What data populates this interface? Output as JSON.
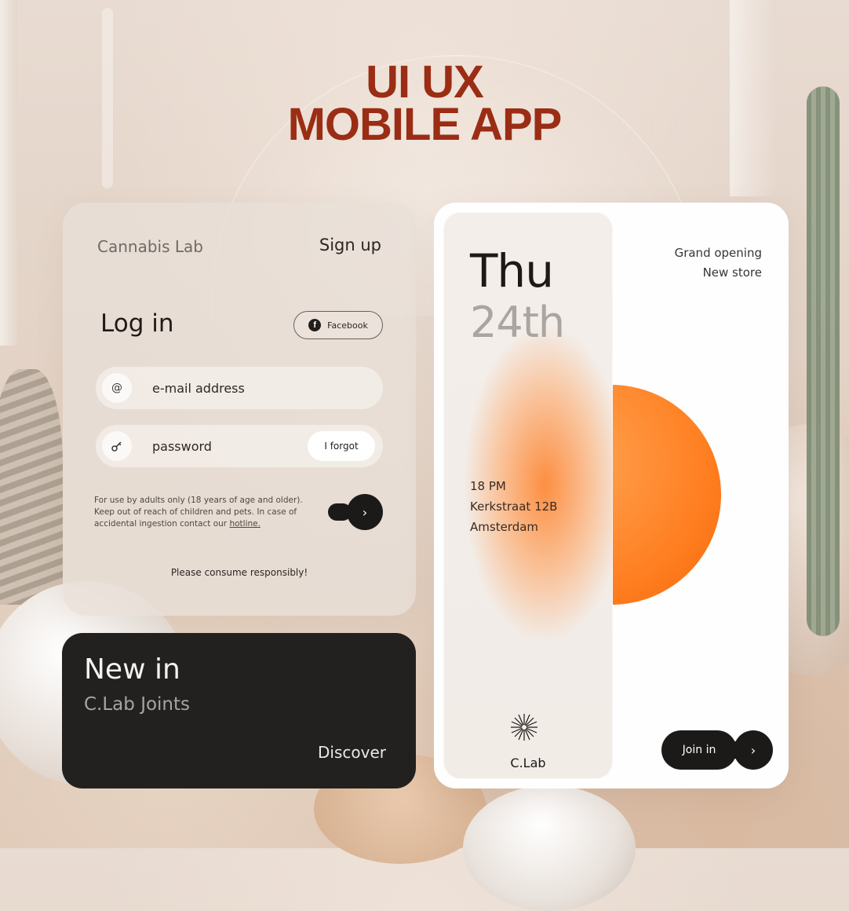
{
  "header": {
    "line1": "UI UX",
    "line2": "MOBILE APP"
  },
  "login": {
    "brand": "Cannabis Lab",
    "signup_label": "Sign up",
    "title": "Log in",
    "facebook_label": "Facebook",
    "email_icon": "@",
    "email_placeholder": "e-mail address",
    "password_placeholder": "password",
    "forgot_label": "I forgot",
    "disclaimer": "For use by adults only (18 years of age and older). Keep out of reach of children and pets. In case of accidental ingestion contact our ",
    "hotline_label": "hotline.",
    "next_glyph": "›",
    "footer_note": "Please consume responsibly!"
  },
  "promo": {
    "title": "New in",
    "subtitle": "C.Lab Joints",
    "cta": "Discover"
  },
  "event": {
    "day": "Thu",
    "date": "24th",
    "tagline_1": "Grand opening",
    "tagline_2": "New store",
    "time": "18 PM",
    "street": "Kerkstraat 12B",
    "city": "Amsterdam",
    "logo_label": "C.Lab",
    "join_label": "Join in",
    "join_glyph": "›"
  },
  "colors": {
    "title": "#9a2d14",
    "accent_orange": "#ff7e20",
    "dark": "#1c1a19"
  },
  "icons": [
    "facebook-icon",
    "at-icon",
    "key-icon",
    "chevron-right-icon",
    "starburst-logo-icon"
  ]
}
